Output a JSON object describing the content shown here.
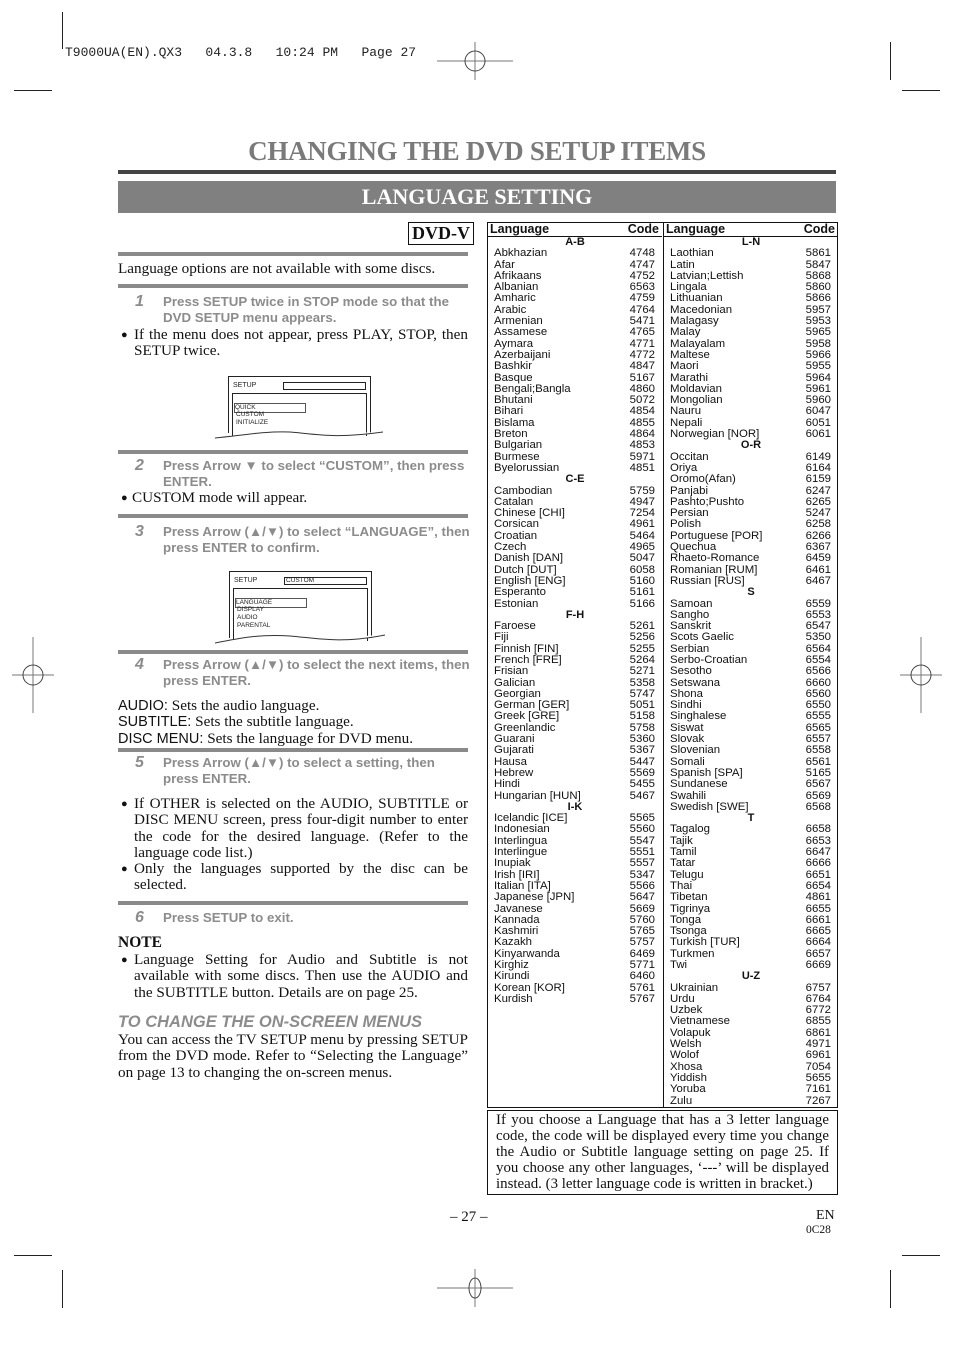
{
  "slug": "T9000UA(EN).QX3   04.3.8   10:24 PM   Page 27",
  "page_title": "CHANGING THE DVD SETUP ITEMS",
  "section_title": "LANGUAGE SETTING",
  "badge": "DVD-V",
  "intro": "Language options are not available with some discs.",
  "steps": [
    {
      "num": "1",
      "text": "Press SETUP twice in STOP mode so that the DVD SETUP menu appears."
    },
    {
      "num": "2",
      "text": "Press Arrow ▼ to select “CUSTOM”, then press ENTER."
    },
    {
      "num": "3",
      "text": "Press Arrow (▲/▼) to select “LANGUAGE”, then press ENTER to confirm."
    },
    {
      "num": "4",
      "text": "Press Arrow (▲/▼) to select the next items, then press ENTER."
    },
    {
      "num": "5",
      "text": "Press Arrow (▲/▼) to select a setting, then press ENTER."
    },
    {
      "num": "6",
      "text": "Press SETUP to exit."
    }
  ],
  "bullets": {
    "step1": "If the menu does not appear, press PLAY, STOP, then SETUP twice.",
    "step2": "CUSTOM mode will appear.",
    "step5a": "If OTHER is selected on the AUDIO, SUBTITLE or DISC MENU screen, press four-digit number to enter the code for the desired language. (Refer to the language code list.)",
    "step5b": "Only the languages supported by the disc can be selected."
  },
  "screen1": {
    "title": "SETUP",
    "field": "",
    "items": [
      "QUICK",
      "CUSTOM",
      "INITIALIZE"
    ],
    "selected": "QUICK"
  },
  "screen2": {
    "title": "SETUP",
    "field": "CUSTOM",
    "items": [
      "LANGUAGE",
      "DISPLAY",
      "AUDIO",
      "PARENTAL"
    ],
    "selected": "LANGUAGE"
  },
  "definitions": [
    {
      "label": "AUDIO:",
      "text": "Sets the audio language."
    },
    {
      "label": "SUBTITLE:",
      "text": "Sets the subtitle language."
    },
    {
      "label": "DISC MENU:",
      "text": "Sets the language for DVD menu."
    }
  ],
  "note": {
    "heading": "NOTE",
    "text": "Language Setting for Audio and Subtitle is not available with some discs. Then use the AUDIO and the SUBTITLE button. Details are on page 25."
  },
  "onscreen": {
    "heading": "TO CHANGE THE ON-SCREEN MENUS",
    "text": "You can access the TV SETUP menu by pressing SETUP from the DVD mode. Refer to “Selecting the Language” on page 13 to changing the on-screen menus."
  },
  "table": {
    "header_language": "Language",
    "header_code": "Code",
    "left": [
      {
        "group": "A-B",
        "rows": [
          [
            "Abkhazian",
            "4748"
          ],
          [
            "Afar",
            "4747"
          ],
          [
            "Afrikaans",
            "4752"
          ],
          [
            "Albanian",
            "6563"
          ],
          [
            "Amharic",
            "4759"
          ],
          [
            "Arabic",
            "4764"
          ],
          [
            "Armenian",
            "5471"
          ],
          [
            "Assamese",
            "4765"
          ],
          [
            "Aymara",
            "4771"
          ],
          [
            "Azerbaijani",
            "4772"
          ],
          [
            "Bashkir",
            "4847"
          ],
          [
            "Basque",
            "5167"
          ],
          [
            "Bengali;Bangla",
            "4860"
          ],
          [
            "Bhutani",
            "5072"
          ],
          [
            "Bihari",
            "4854"
          ],
          [
            "Bislama",
            "4855"
          ],
          [
            "Breton",
            "4864"
          ],
          [
            "Bulgarian",
            "4853"
          ],
          [
            "Burmese",
            "5971"
          ],
          [
            "Byelorussian",
            "4851"
          ]
        ]
      },
      {
        "group": "C-E",
        "rows": [
          [
            "Cambodian",
            "5759"
          ],
          [
            "Catalan",
            "4947"
          ],
          [
            "Chinese [CHI]",
            "7254"
          ],
          [
            "Corsican",
            "4961"
          ],
          [
            "Croatian",
            "5464"
          ],
          [
            "Czech",
            "4965"
          ],
          [
            "Danish [DAN]",
            "5047"
          ],
          [
            "Dutch [DUT]",
            "6058"
          ],
          [
            "English [ENG]",
            "5160"
          ],
          [
            "Esperanto",
            "5161"
          ],
          [
            "Estonian",
            "5166"
          ]
        ]
      },
      {
        "group": "F-H",
        "rows": [
          [
            "Faroese",
            "5261"
          ],
          [
            "Fiji",
            "5256"
          ],
          [
            "Finnish [FIN]",
            "5255"
          ],
          [
            "French [FRE]",
            "5264"
          ],
          [
            "Frisian",
            "5271"
          ],
          [
            "Galician",
            "5358"
          ],
          [
            "Georgian",
            "5747"
          ],
          [
            "German [GER]",
            "5051"
          ],
          [
            "Greek [GRE]",
            "5158"
          ],
          [
            "Greenlandic",
            "5758"
          ],
          [
            "Guarani",
            "5360"
          ],
          [
            "Gujarati",
            "5367"
          ],
          [
            "Hausa",
            "5447"
          ],
          [
            "Hebrew",
            "5569"
          ],
          [
            "Hindi",
            "5455"
          ],
          [
            "Hungarian [HUN]",
            "5467"
          ]
        ]
      },
      {
        "group": "I-K",
        "rows": [
          [
            "Icelandic [ICE]",
            "5565"
          ],
          [
            "Indonesian",
            "5560"
          ],
          [
            "Interlingua",
            "5547"
          ],
          [
            "Interlingue",
            "5551"
          ],
          [
            "Inupiak",
            "5557"
          ],
          [
            "Irish [IRI]",
            "5347"
          ],
          [
            "Italian [ITA]",
            "5566"
          ],
          [
            "Japanese [JPN]",
            "5647"
          ],
          [
            "Javanese",
            "5669"
          ],
          [
            "Kannada",
            "5760"
          ],
          [
            "Kashmiri",
            "5765"
          ],
          [
            "Kazakh",
            "5757"
          ],
          [
            "Kinyarwanda",
            "6469"
          ],
          [
            "Kirghiz",
            "5771"
          ],
          [
            "Kirundi",
            "6460"
          ],
          [
            "Korean [KOR]",
            "5761"
          ],
          [
            "Kurdish",
            "5767"
          ]
        ]
      }
    ],
    "right": [
      {
        "group": "L-N",
        "rows": [
          [
            "Laothian",
            "5861"
          ],
          [
            "Latin",
            "5847"
          ],
          [
            "Latvian;Lettish",
            "5868"
          ],
          [
            "Lingala",
            "5860"
          ],
          [
            "Lithuanian",
            "5866"
          ],
          [
            "Macedonian",
            "5957"
          ],
          [
            "Malagasy",
            "5953"
          ],
          [
            "Malay",
            "5965"
          ],
          [
            "Malayalam",
            "5958"
          ],
          [
            "Maltese",
            "5966"
          ],
          [
            "Maori",
            "5955"
          ],
          [
            "Marathi",
            "5964"
          ],
          [
            "Moldavian",
            "5961"
          ],
          [
            "Mongolian",
            "5960"
          ],
          [
            "Nauru",
            "6047"
          ],
          [
            "Nepali",
            "6051"
          ],
          [
            "Norwegian [NOR]",
            "6061"
          ]
        ]
      },
      {
        "group": "O-R",
        "rows": [
          [
            "Occitan",
            "6149"
          ],
          [
            "Oriya",
            "6164"
          ],
          [
            "Oromo(Afan)",
            "6159"
          ],
          [
            "Panjabi",
            "6247"
          ],
          [
            "Pashto;Pushto",
            "6265"
          ],
          [
            "Persian",
            "5247"
          ],
          [
            "Polish",
            "6258"
          ],
          [
            "Portuguese [POR]",
            "6266"
          ],
          [
            "Quechua",
            "6367"
          ],
          [
            "Rhaeto-Romance",
            "6459"
          ],
          [
            "Romanian [RUM]",
            "6461"
          ],
          [
            "Russian [RUS]",
            "6467"
          ]
        ]
      },
      {
        "group": "S",
        "rows": [
          [
            "Samoan",
            "6559"
          ],
          [
            "Sangho",
            "6553"
          ],
          [
            "Sanskrit",
            "6547"
          ],
          [
            "Scots Gaelic",
            "5350"
          ],
          [
            "Serbian",
            "6564"
          ],
          [
            "Serbo-Croatian",
            "6554"
          ],
          [
            "Sesotho",
            "6566"
          ],
          [
            "Setswana",
            "6660"
          ],
          [
            "Shona",
            "6560"
          ],
          [
            "Sindhi",
            "6550"
          ],
          [
            "Singhalese",
            "6555"
          ],
          [
            "Siswat",
            "6565"
          ],
          [
            "Slovak",
            "6557"
          ],
          [
            "Slovenian",
            "6558"
          ],
          [
            "Somali",
            "6561"
          ],
          [
            "Spanish [SPA]",
            "5165"
          ],
          [
            "Sundanese",
            "6567"
          ],
          [
            "Swahili",
            "6569"
          ],
          [
            "Swedish [SWE]",
            "6568"
          ]
        ]
      },
      {
        "group": "T",
        "rows": [
          [
            "Tagalog",
            "6658"
          ],
          [
            "Tajik",
            "6653"
          ],
          [
            "Tamil",
            "6647"
          ],
          [
            "Tatar",
            "6666"
          ],
          [
            "Telugu",
            "6651"
          ],
          [
            "Thai",
            "6654"
          ],
          [
            "Tibetan",
            "4861"
          ],
          [
            "Tigrinya",
            "6655"
          ],
          [
            "Tonga",
            "6661"
          ],
          [
            "Tsonga",
            "6665"
          ],
          [
            "Turkish [TUR]",
            "6664"
          ],
          [
            "Turkmen",
            "6657"
          ],
          [
            "Twi",
            "6669"
          ]
        ]
      },
      {
        "group": "U-Z",
        "rows": [
          [
            "Ukrainian",
            "6757"
          ],
          [
            "Urdu",
            "6764"
          ],
          [
            "Uzbek",
            "6772"
          ],
          [
            "Vietnamese",
            "6855"
          ],
          [
            "Volapuk",
            "6861"
          ],
          [
            "Welsh",
            "4971"
          ],
          [
            "Wolof",
            "6961"
          ],
          [
            "Xhosa",
            "7054"
          ],
          [
            "Yiddish",
            "5655"
          ],
          [
            "Yoruba",
            "7161"
          ],
          [
            "Zulu",
            "7267"
          ]
        ]
      }
    ]
  },
  "notice": "If you choose a Language that has a 3 letter language code, the code will be displayed every time you change the Audio or Subtitle language setting on page 25. If you choose any other languages, ‘---’ will be displayed instead. (3 letter language code is written in bracket.)",
  "footer": {
    "page": "– 27 –",
    "lang": "EN",
    "code": "0C28"
  }
}
